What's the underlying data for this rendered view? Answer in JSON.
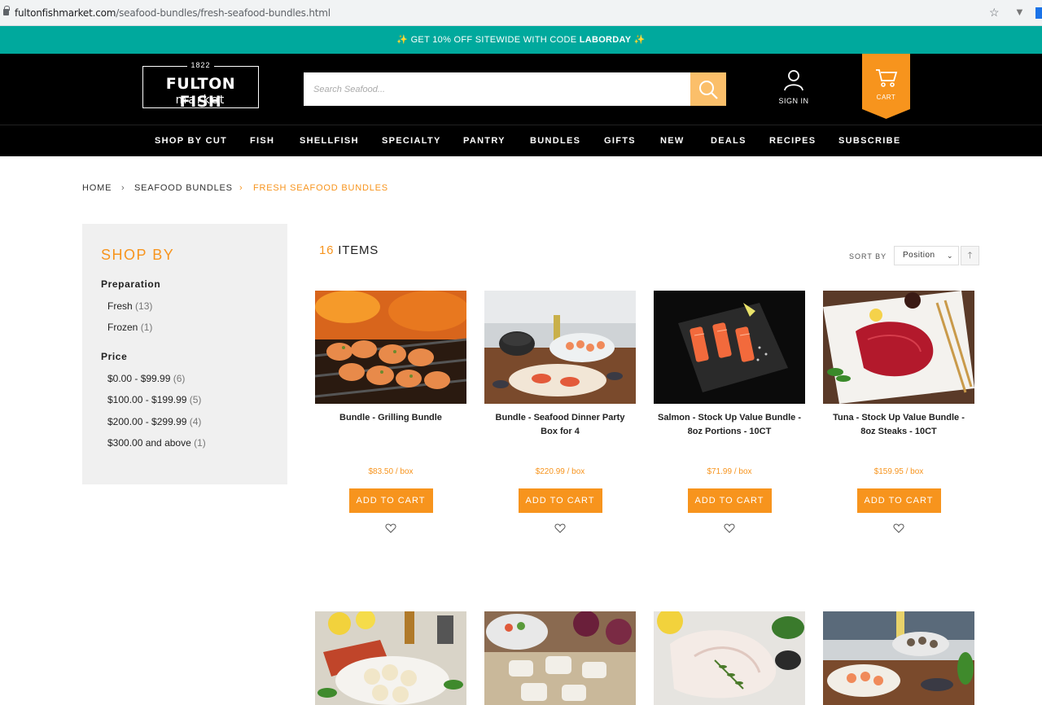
{
  "browser": {
    "url_host": "fultonfishmarket.com",
    "url_path": "/seafood-bundles/fresh-seafood-bundles.html"
  },
  "promo": {
    "prefix": "✨ GET 10% OFF SITEWIDE WITH CODE ",
    "code": "LABORDAY",
    "suffix": " ✨"
  },
  "header": {
    "logo_year": "1822",
    "logo_line1": "FULTON FISH",
    "logo_line2": "market",
    "search_placeholder": "Search Seafood...",
    "signin_label": "SIGN IN",
    "cart_label": "CART"
  },
  "nav": [
    "SHOP BY CUT",
    "FISH",
    "SHELLFISH",
    "SPECIALTY",
    "PANTRY",
    "BUNDLES",
    "GIFTS",
    "NEW",
    "DEALS",
    "RECIPES",
    "SUBSCRIBE"
  ],
  "breadcrumb": {
    "home": "HOME",
    "sep": "›",
    "parent": "SEAFOOD BUNDLES",
    "current": "FRESH SEAFOOD BUNDLES"
  },
  "sidebar": {
    "title": "SHOP BY",
    "groups": [
      {
        "label": "Preparation",
        "options": [
          {
            "label": "Fresh",
            "count": "(13)"
          },
          {
            "label": "Frozen",
            "count": "(1)"
          }
        ]
      },
      {
        "label": "Price",
        "options": [
          {
            "label": "$0.00 - $99.99",
            "count": "(6)"
          },
          {
            "label": "$100.00 - $199.99",
            "count": "(5)"
          },
          {
            "label": "$200.00 - $299.99",
            "count": "(4)"
          },
          {
            "label": "$300.00 and above",
            "count": "(1)"
          }
        ]
      }
    ]
  },
  "toolbar": {
    "count": "16",
    "count_label": " ITEMS",
    "sort_label": "SORT BY",
    "sort_value": "Position"
  },
  "products": [
    {
      "name": "Bundle - Grilling Bundle",
      "price": "$83.50 / box",
      "add": "ADD TO CART"
    },
    {
      "name": "Bundle - Seafood Dinner Party Box for 4",
      "price": "$220.99 / box",
      "add": "ADD TO CART"
    },
    {
      "name": "Salmon - Stock Up Value Bundle - 8oz Portions - 10CT",
      "price": "$71.99 / box",
      "add": "ADD TO CART"
    },
    {
      "name": "Tuna - Stock Up Value Bundle - 8oz Steaks - 10CT",
      "price": "$159.95 / box",
      "add": "ADD TO CART"
    }
  ],
  "colors": {
    "accent": "#f7941d",
    "promo": "#00a99d",
    "header": "#000000"
  }
}
